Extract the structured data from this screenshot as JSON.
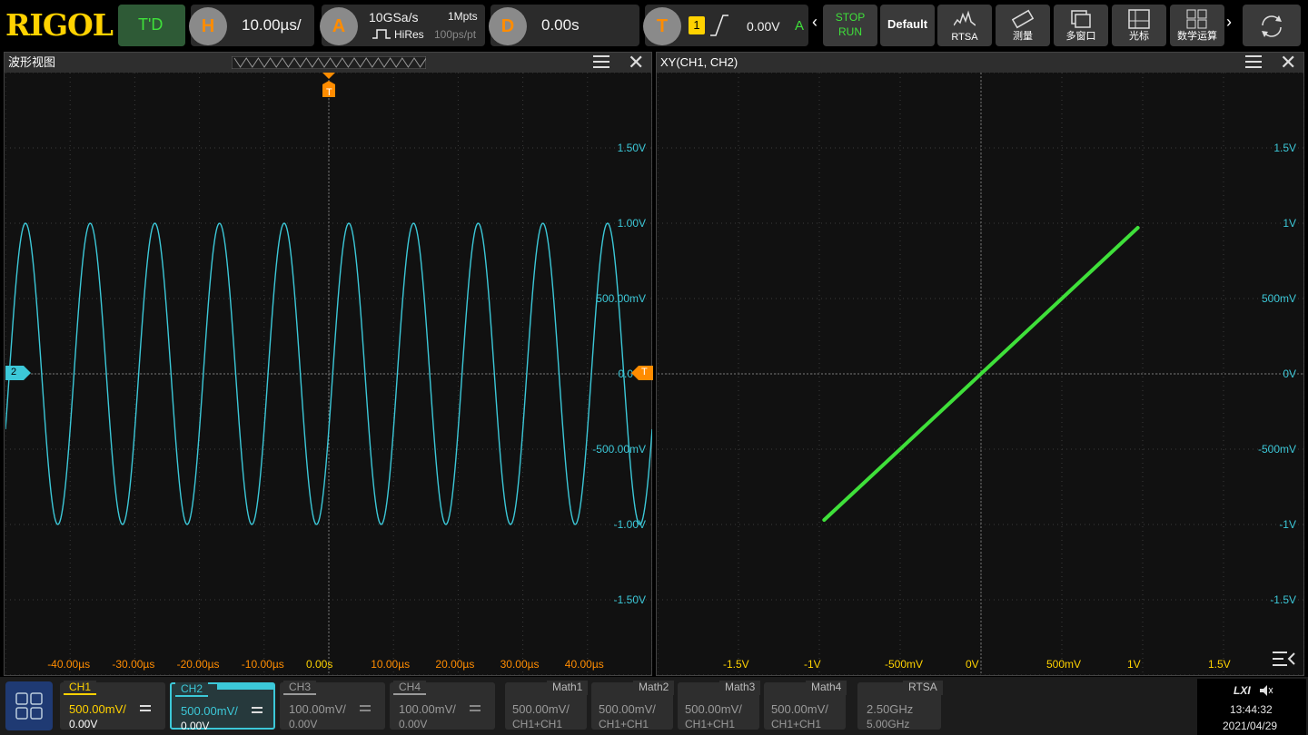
{
  "brand": "RIGOL",
  "topbar": {
    "td_label": "T'D",
    "h_label": "H",
    "h_value": "10.00µs/",
    "a_label": "A",
    "sample_rate": "10GSa/s",
    "mem_depth": "1Mpts",
    "acq_mode": "HiRes",
    "pts_rate": "100ps/pt",
    "d_label": "D",
    "d_value": "0.00s",
    "t_label": "T",
    "trig_source": "1",
    "trig_level": "0.00V",
    "trig_mode": "A",
    "stop_label": "STOP",
    "run_label": "RUN",
    "default_label": "Default",
    "rtsa_label": "RTSA",
    "measure_label": "测量",
    "multiwin_label": "多窗口",
    "cursor_label": "光标",
    "math_label": "数学运算"
  },
  "waveform_panel": {
    "title": "波形视图",
    "trigger_marker": "T",
    "channel_marker": "2",
    "right_trigger_marker": "T",
    "y_labels": [
      "1.50V",
      "1.00V",
      "500.00mV",
      "0.0",
      "-500.00mV",
      "-1.00V",
      "-1.50V"
    ],
    "x_labels": [
      "-40.00µs",
      "-30.00µs",
      "-20.00µs",
      "-10.00µs",
      "0.00s",
      "10.00µs",
      "20.00µs",
      "30.00µs",
      "40.00µs"
    ]
  },
  "xy_panel": {
    "title": "XY(CH1, CH2)",
    "y_labels": [
      "1.5V",
      "1V",
      "500mV",
      "0V",
      "-500mV",
      "-1V",
      "-1.5V"
    ],
    "x_labels": [
      "-1.5V",
      "-1V",
      "-500mV",
      "0V",
      "500mV",
      "1V",
      "1.5V"
    ]
  },
  "channels": [
    {
      "name": "CH1",
      "scale": "500.00mV/",
      "offset": "0.00V",
      "color": "#ffd200",
      "active": true
    },
    {
      "name": "CH2",
      "scale": "500.00mV/",
      "offset": "0.00V",
      "color": "#3cc8d8",
      "active": true,
      "selected": true
    },
    {
      "name": "CH3",
      "scale": "100.00mV/",
      "offset": "0.00V",
      "color": "#9a9a9a",
      "active": false
    },
    {
      "name": "CH4",
      "scale": "100.00mV/",
      "offset": "0.00V",
      "color": "#9a9a9a",
      "active": false
    }
  ],
  "maths": [
    {
      "name": "Math1",
      "scale": "500.00mV/",
      "src": "CH1+CH1"
    },
    {
      "name": "Math2",
      "scale": "500.00mV/",
      "src": "CH1+CH1"
    },
    {
      "name": "Math3",
      "scale": "500.00mV/",
      "src": "CH1+CH1"
    },
    {
      "name": "Math4",
      "scale": "500.00mV/",
      "src": "CH1+CH1"
    }
  ],
  "rtsa": {
    "name": "RTSA",
    "center": "2.50GHz",
    "span": "5.00GHz"
  },
  "status": {
    "lxi": "LXI",
    "time": "13:44:32",
    "date": "2021/04/29"
  },
  "colors": {
    "ch1": "#ffd200",
    "ch2": "#3cc8d8",
    "xy_trace": "#3fe03a",
    "trigger": "#ff8c00"
  },
  "chart_data": [
    {
      "type": "line",
      "series": [
        {
          "values_desc": "sine",
          "amplitude_v": 1.0,
          "period_us": 10.0
        }
      ],
      "xlim_us": [
        -50,
        50
      ],
      "ylim_v": [
        -2,
        2
      ]
    },
    {
      "type": "line",
      "x": [
        -0.97,
        0.97
      ],
      "y": [
        -0.97,
        0.97
      ],
      "xlim": [
        -2,
        2
      ],
      "ylim": [
        -2,
        2
      ]
    }
  ]
}
